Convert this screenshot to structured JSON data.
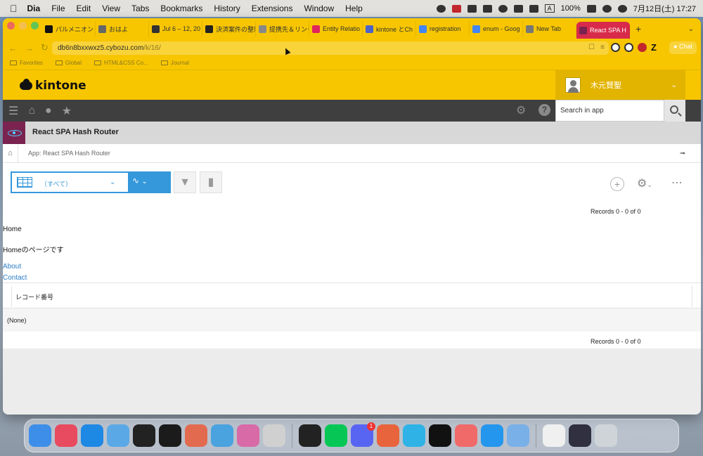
{
  "menubar": {
    "app": "Dia",
    "items": [
      "File",
      "Edit",
      "View",
      "Tabs",
      "Bookmarks",
      "History",
      "Extensions",
      "Window",
      "Help"
    ],
    "battery": "100%",
    "clock": "7月12日(土)  17:27",
    "input_indicator": "A"
  },
  "tabs": [
    {
      "title": "パルメニオン",
      "icon": "x-icon",
      "color": "#111111"
    },
    {
      "title": "おはよ",
      "icon": "chat-bubble-icon",
      "color": "#666666"
    },
    {
      "title": "Jul 6 – 12, 20",
      "icon": "calendar-icon",
      "color": "#333333"
    },
    {
      "title": "決済案件の整理",
      "icon": "notion-icon",
      "color": "#222222"
    },
    {
      "title": "提携先＆リンク",
      "icon": "doc-icon",
      "color": "#888888"
    },
    {
      "title": "Entity Relatio",
      "icon": "v-icon",
      "color": "#e0245e"
    },
    {
      "title": "kintone とCh",
      "icon": "kintone-icon",
      "color": "#4a63c9"
    },
    {
      "title": "registration",
      "icon": "google-icon",
      "color": "#4285f4"
    },
    {
      "title": "enum - Goog",
      "icon": "google-icon",
      "color": "#4285f4"
    },
    {
      "title": "New Tab",
      "icon": "globe-icon",
      "color": "#777777"
    },
    {
      "title": "React SPA H",
      "icon": "app-icon",
      "color": "#7a2350",
      "active": true
    }
  ],
  "address": {
    "url_host": "db6n8bxxwxz5.cybozu.com",
    "url_path": "/k/16/",
    "chat_label": "Chat"
  },
  "bookmarks": [
    "Favorites",
    "Global",
    "HTML&CSS Co...",
    "Journal"
  ],
  "kintone": {
    "logo": "kintone",
    "user_name": "木元賢聖",
    "search_placeholder": "Search in app",
    "app_title": "React SPA Hash Router",
    "breadcrumb": "App: React SPA Hash Router",
    "view_name": "（すべて）",
    "records_top": "Records 0 - 0 of 0",
    "records_bottom": "Records 0 - 0 of 0",
    "home_heading": "Home",
    "home_text": "Homeのページです",
    "links": [
      "About",
      "Contact"
    ],
    "table_header": "レコード番号",
    "table_row": "(None)"
  },
  "dock": [
    {
      "name": "finder-icon",
      "color": "#3d8ee8"
    },
    {
      "name": "launchpad-icon",
      "color": "#e84a5f"
    },
    {
      "name": "vscode-icon",
      "color": "#1e88e5"
    },
    {
      "name": "xcode-simulator-icon",
      "color": "#5aa9e6"
    },
    {
      "name": "unity-icon",
      "color": "#222222"
    },
    {
      "name": "zed-icon",
      "color": "#1b1b1b"
    },
    {
      "name": "iphone-mirroring-icon",
      "color": "#e26b4f"
    },
    {
      "name": "columns-app-icon",
      "color": "#4aa3df"
    },
    {
      "name": "affinity-icon",
      "color": "#d86aa8"
    },
    {
      "name": "parallels-icon",
      "color": "#d0d0d0"
    },
    {
      "name": "activity-monitor-icon",
      "color": "#222222"
    },
    {
      "name": "line-icon",
      "color": "#06c755"
    },
    {
      "name": "discord-icon",
      "color": "#5865f2",
      "badge": "1"
    },
    {
      "name": "perplexity-icon",
      "color": "#e8643c"
    },
    {
      "name": "proxyman-icon",
      "color": "#2fb3e6"
    },
    {
      "name": "terminal-icon",
      "color": "#111111"
    },
    {
      "name": "asana-icon",
      "color": "#f06a6a"
    },
    {
      "name": "docker-icon",
      "color": "#2496ed"
    },
    {
      "name": "arc-icon",
      "color": "#7ab0e8"
    },
    {
      "name": "screenshot-thumb-icon",
      "color": "#f0f0f0"
    },
    {
      "name": "screenshot-thumb-icon-2",
      "color": "#303040"
    },
    {
      "name": "trash-icon",
      "color": "#cfd4d8"
    }
  ]
}
